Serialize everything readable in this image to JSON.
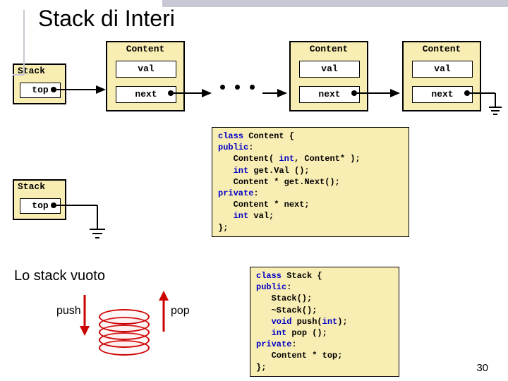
{
  "title": "Stack di Interi",
  "node_label": "Content",
  "field_val": "val",
  "field_next": "next",
  "stack_label": "Stack",
  "top_label": "top",
  "empty_stack_label": "Lo stack vuoto",
  "push_label": "push",
  "pop_label": "pop",
  "slide_number": "30",
  "code_content": {
    "l1": "class",
    "l1b": " Content {",
    "l2": "public",
    "l2b": ":",
    "l3a": "   Content( ",
    "l3b": "int",
    "l3c": ", Content* );",
    "l4a": "   ",
    "l4b": "int",
    "l4c": " get.Val ();",
    "l5": "   Content * get.Next();",
    "l6": "private",
    "l6b": ":",
    "l7": "   Content * next;",
    "l8a": "   ",
    "l8b": "int",
    "l8c": " val;",
    "l9": "};"
  },
  "code_stack": {
    "l1": "class",
    "l1b": " Stack {",
    "l2": "public",
    "l2b": ":",
    "l3": "   Stack();",
    "l4": "   ~Stack();",
    "l5a": "   ",
    "l5b": "void",
    "l5c": " push(",
    "l5d": "int",
    "l5e": ");",
    "l6a": "   ",
    "l6b": "int",
    "l6c": " pop ();",
    "l7": "private",
    "l7b": ":",
    "l8": "   Content * top;",
    "l9": "};"
  }
}
